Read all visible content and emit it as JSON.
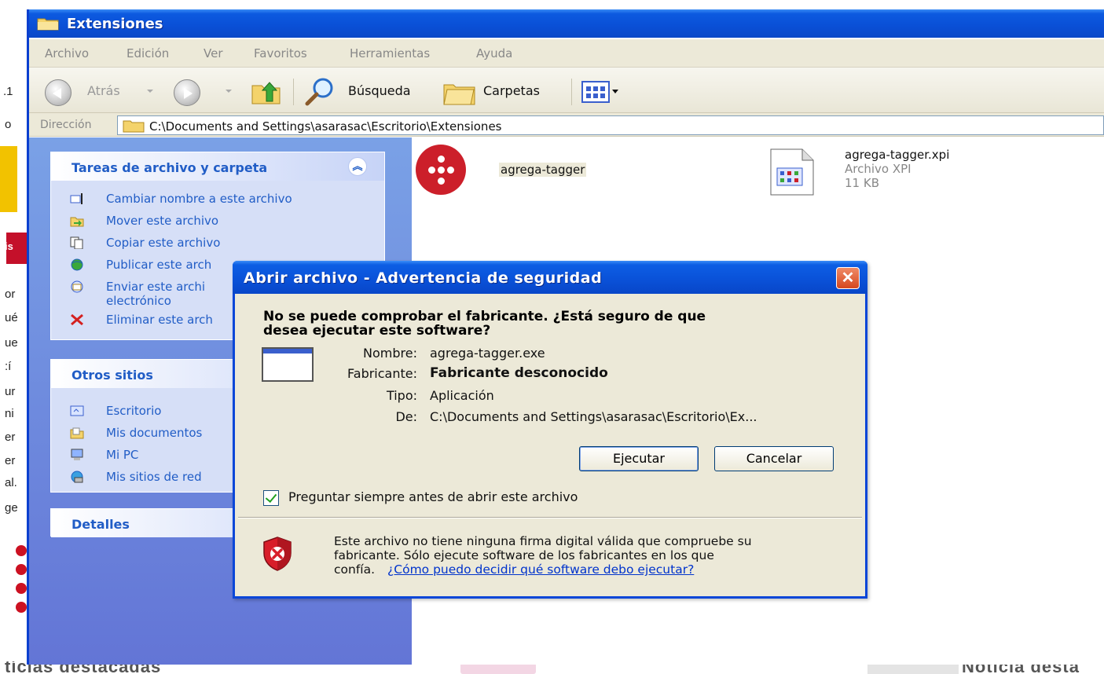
{
  "background": {
    "bottom_left_text": "tícias destacadas",
    "bottom_right_text": "Noticia desta",
    "left_fragments": [
      ".1",
      "o",
      "is",
      "or",
      "ué",
      "ue",
      ":í",
      "ur",
      "ni",
      "er",
      "er",
      "al.",
      "ge"
    ]
  },
  "explorer": {
    "title": "Extensiones",
    "menu": [
      "Archivo",
      "Edición",
      "Ver",
      "Favoritos",
      "Herramientas",
      "Ayuda"
    ],
    "toolbar": {
      "back_label": "Atrás",
      "search_label": "Búsqueda",
      "folders_label": "Carpetas"
    },
    "address": {
      "label": "Dirección",
      "path": "C:\\Documents and Settings\\asarasac\\Escritorio\\Extensiones"
    },
    "tasks_panel": {
      "title": "Tareas de archivo y carpeta",
      "items": [
        "Cambiar nombre a este archivo",
        "Mover este archivo",
        "Copiar este archivo",
        "Publicar este arch",
        "Enviar este archi",
        "electrónico",
        "Eliminar este arch"
      ]
    },
    "places_panel": {
      "title": "Otros sitios",
      "items": [
        "Escritorio",
        "Mis documentos",
        "Mi PC",
        "Mis sitios de red"
      ]
    },
    "details_panel": {
      "title": "Detalles"
    },
    "files": [
      {
        "name": "agrega-tagger"
      },
      {
        "name": "agrega-tagger.xpi",
        "type": "Archivo XPI",
        "size": "11 KB"
      }
    ]
  },
  "dialog": {
    "title": "Abrir archivo - Advertencia de seguridad",
    "close_glyph": "✕",
    "question_line1": "No se puede comprobar el fabricante. ¿Está seguro de que",
    "question_line2": "desea ejecutar este software?",
    "fields": {
      "name_key": "Nombre:",
      "name_val": "agrega-tagger.exe",
      "publisher_key": "Fabricante:",
      "publisher_val": "Fabricante desconocido",
      "type_key": "Tipo:",
      "type_val": "Aplicación",
      "from_key": "De:",
      "from_val": "C:\\Documents and Settings\\asarasac\\Escritorio\\Ex..."
    },
    "run_button": "Ejecutar",
    "cancel_button": "Cancelar",
    "checkbox_label": "Preguntar siempre antes de abrir este archivo",
    "warning_line1": "Este archivo no tiene ninguna firma digital válida que compruebe su",
    "warning_line2": "fabricante.  Sólo ejecute software de los fabricantes en los que",
    "warning_line3": "confía.",
    "warning_link": "¿Cómo puedo decidir qué software debo ejecutar?"
  },
  "colors": {
    "xp_blue": "#0a52d9",
    "taskpane": "#6f8fe0",
    "dialog_bg": "#ece9d8",
    "logo_red": "#cc1f2a"
  }
}
